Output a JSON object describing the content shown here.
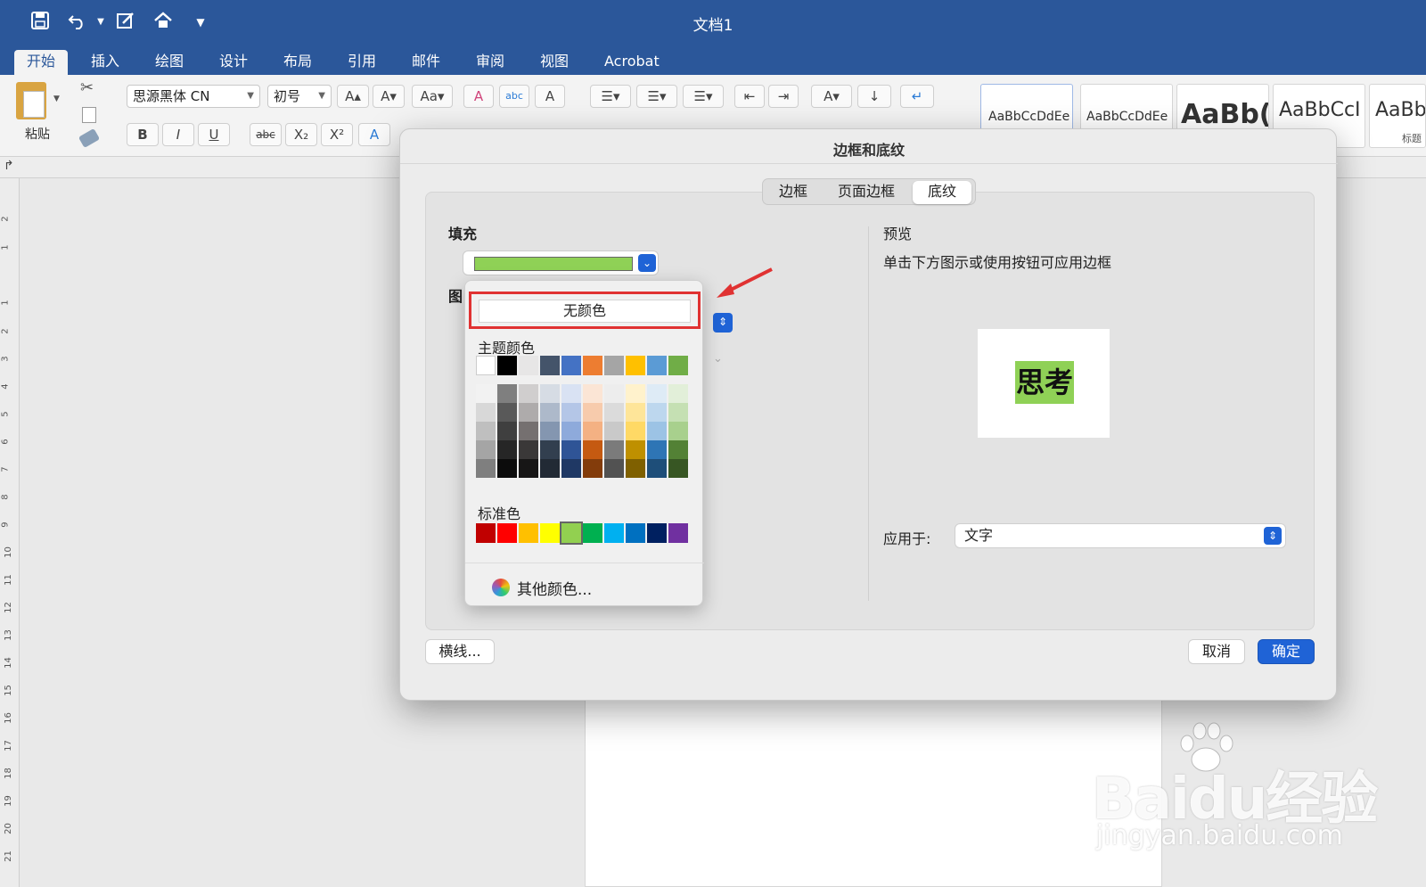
{
  "window": {
    "title": "文档1"
  },
  "quick_access": [
    "save-icon",
    "undo-icon",
    "edit-icon",
    "home-icon",
    "more-icon"
  ],
  "tabs": [
    {
      "label": "开始",
      "active": true
    },
    {
      "label": "插入"
    },
    {
      "label": "绘图"
    },
    {
      "label": "设计"
    },
    {
      "label": "布局"
    },
    {
      "label": "引用"
    },
    {
      "label": "邮件"
    },
    {
      "label": "审阅"
    },
    {
      "label": "视图"
    },
    {
      "label": "Acrobat"
    }
  ],
  "ribbon": {
    "paste_label": "粘贴",
    "font_name": "思源黑体 CN",
    "font_size": "初号",
    "format_buttons": [
      "B",
      "I",
      "U",
      "abc",
      "X₂",
      "X²"
    ],
    "styles": [
      {
        "text": "AaBbCcDdEe"
      },
      {
        "text": "AaBbCcDdEe"
      },
      {
        "text": "AaBb("
      },
      {
        "text": "AaBbCcI"
      },
      {
        "text": "AaBb",
        "caption": "标题"
      }
    ]
  },
  "vruler_numbers": [
    "2",
    "1",
    "1",
    "2",
    "3",
    "4",
    "5",
    "6",
    "7",
    "8",
    "9",
    "10",
    "11",
    "12",
    "13",
    "14",
    "15",
    "16",
    "17",
    "18",
    "19",
    "20",
    "21"
  ],
  "dialog": {
    "title": "边框和底纹",
    "tabs": [
      {
        "label": "边框"
      },
      {
        "label": "页面边框"
      },
      {
        "label": "底纹",
        "active": true
      }
    ],
    "fill_label": "填充",
    "fill_color": "#8fd156",
    "pattern_label_partial": "图",
    "preview_label": "预览",
    "preview_hint": "单击下方图示或使用按钮可应用边框",
    "preview_text": "思考",
    "preview_bg": "#8fd156",
    "apply_label": "应用于:",
    "apply_value": "文字",
    "hline_button": "横线...",
    "cancel_button": "取消",
    "ok_button": "确定"
  },
  "color_popup": {
    "no_color": "无颜色",
    "theme_label": "主题颜色",
    "theme_top": [
      "#ffffff",
      "#000000",
      "#e7e6e6",
      "#44546a",
      "#4472c4",
      "#ed7d31",
      "#a5a5a5",
      "#ffc000",
      "#5b9bd5",
      "#70ad47"
    ],
    "theme_shades": [
      [
        "#f2f2f2",
        "#7f7f7f",
        "#d0cece",
        "#d6dce4",
        "#d9e2f3",
        "#fbe5d5",
        "#ededed",
        "#fff2cc",
        "#deebf6",
        "#e2efd9"
      ],
      [
        "#d8d8d8",
        "#595959",
        "#aeabab",
        "#adb9ca",
        "#b4c6e7",
        "#f7cbac",
        "#dbdbdb",
        "#fee599",
        "#bdd7ee",
        "#c5e0b3"
      ],
      [
        "#bfbfbf",
        "#3f3f3f",
        "#757070",
        "#8496b0",
        "#8eaadb",
        "#f4b183",
        "#c9c9c9",
        "#ffd965",
        "#9cc3e5",
        "#a8d08d"
      ],
      [
        "#a5a5a5",
        "#262626",
        "#3a3838",
        "#323f4f",
        "#2f5496",
        "#c55a11",
        "#7b7b7b",
        "#bf9000",
        "#2e75b5",
        "#538135"
      ],
      [
        "#7f7f7f",
        "#0c0c0c",
        "#171616",
        "#222a35",
        "#1f3864",
        "#833c0b",
        "#525252",
        "#7f6000",
        "#1e4e79",
        "#375623"
      ]
    ],
    "standard_label": "标准色",
    "standard": [
      "#c00000",
      "#ff0000",
      "#ffc000",
      "#ffff00",
      "#92d050",
      "#00b050",
      "#00b0f0",
      "#0070c0",
      "#002060",
      "#7030a0"
    ],
    "standard_selected_index": 4,
    "more_colors": "其他颜色..."
  },
  "watermark": {
    "line1": "Baidu经验",
    "line2": "jingyan.baidu.com"
  }
}
